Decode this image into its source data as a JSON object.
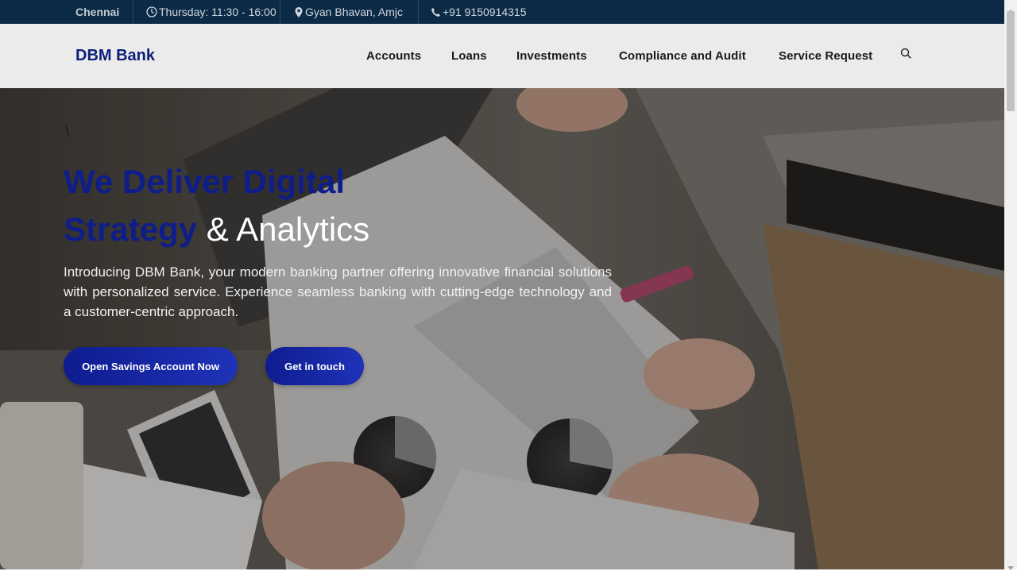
{
  "topbar": {
    "city": "Chennai",
    "hours": "Thursday: 11:30 - 16:00",
    "location": "Gyan Bhavan, Amjc",
    "phone": "+91 9150914315",
    "icons": [
      "clock-icon",
      "location-pin-icon",
      "phone-icon"
    ]
  },
  "header": {
    "brand": "DBM Bank",
    "nav": [
      "Accounts",
      "Loans",
      "Investments",
      "Compliance and Audit",
      "Service Request"
    ],
    "search_icon": "search-icon"
  },
  "hero": {
    "backslash": "\\",
    "headline_line1": "We Deliver Digital",
    "headline_line2_strong": "Strategy",
    "headline_line2_rest": "& Analytics",
    "intro": "Introducing DBM Bank, your modern banking partner offering innovative financial solutions with personalized service. Experience seamless banking with cutting-edge technology and a customer-centric approach.",
    "cta_primary": "Open Savings Account Now",
    "cta_secondary": "Get in touch"
  },
  "colors": {
    "topbar_bg": "#0b2a45",
    "header_bg": "#ebebeb",
    "brand_blue": "#0d1f78",
    "headline_blue": "#0f1d8a",
    "button_blue": "#1a2aa8"
  }
}
